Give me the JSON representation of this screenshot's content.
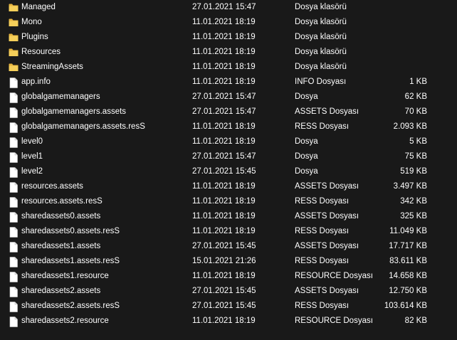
{
  "files": [
    {
      "name": "Managed",
      "date": "27.01.2021 15:47",
      "type": "Dosya klasörü",
      "size": "",
      "icon": "folder-icon"
    },
    {
      "name": "Mono",
      "date": "11.01.2021 18:19",
      "type": "Dosya klasörü",
      "size": "",
      "icon": "folder-icon"
    },
    {
      "name": "Plugins",
      "date": "11.01.2021 18:19",
      "type": "Dosya klasörü",
      "size": "",
      "icon": "folder-icon"
    },
    {
      "name": "Resources",
      "date": "11.01.2021 18:19",
      "type": "Dosya klasörü",
      "size": "",
      "icon": "folder-icon"
    },
    {
      "name": "StreamingAssets",
      "date": "11.01.2021 18:19",
      "type": "Dosya klasörü",
      "size": "",
      "icon": "folder-icon"
    },
    {
      "name": "app.info",
      "date": "11.01.2021 18:19",
      "type": "INFO Dosyası",
      "size": "1 KB",
      "icon": "file-icon"
    },
    {
      "name": "globalgamemanagers",
      "date": "27.01.2021 15:47",
      "type": "Dosya",
      "size": "62 KB",
      "icon": "file-icon"
    },
    {
      "name": "globalgamemanagers.assets",
      "date": "27.01.2021 15:47",
      "type": "ASSETS Dosyası",
      "size": "70 KB",
      "icon": "file-icon"
    },
    {
      "name": "globalgamemanagers.assets.resS",
      "date": "11.01.2021 18:19",
      "type": "RESS Dosyası",
      "size": "2.093 KB",
      "icon": "file-icon"
    },
    {
      "name": "level0",
      "date": "11.01.2021 18:19",
      "type": "Dosya",
      "size": "5 KB",
      "icon": "file-icon"
    },
    {
      "name": "level1",
      "date": "27.01.2021 15:47",
      "type": "Dosya",
      "size": "75 KB",
      "icon": "file-icon"
    },
    {
      "name": "level2",
      "date": "27.01.2021 15:45",
      "type": "Dosya",
      "size": "519 KB",
      "icon": "file-icon"
    },
    {
      "name": "resources.assets",
      "date": "11.01.2021 18:19",
      "type": "ASSETS Dosyası",
      "size": "3.497 KB",
      "icon": "file-icon"
    },
    {
      "name": "resources.assets.resS",
      "date": "11.01.2021 18:19",
      "type": "RESS Dosyası",
      "size": "342 KB",
      "icon": "file-icon"
    },
    {
      "name": "sharedassets0.assets",
      "date": "11.01.2021 18:19",
      "type": "ASSETS Dosyası",
      "size": "325 KB",
      "icon": "file-icon"
    },
    {
      "name": "sharedassets0.assets.resS",
      "date": "11.01.2021 18:19",
      "type": "RESS Dosyası",
      "size": "11.049 KB",
      "icon": "file-icon"
    },
    {
      "name": "sharedassets1.assets",
      "date": "27.01.2021 15:45",
      "type": "ASSETS Dosyası",
      "size": "17.717 KB",
      "icon": "file-icon"
    },
    {
      "name": "sharedassets1.assets.resS",
      "date": "15.01.2021 21:26",
      "type": "RESS Dosyası",
      "size": "83.611 KB",
      "icon": "file-icon"
    },
    {
      "name": "sharedassets1.resource",
      "date": "11.01.2021 18:19",
      "type": "RESOURCE Dosyası",
      "size": "14.658 KB",
      "icon": "file-icon"
    },
    {
      "name": "sharedassets2.assets",
      "date": "27.01.2021 15:45",
      "type": "ASSETS Dosyası",
      "size": "12.750 KB",
      "icon": "file-icon"
    },
    {
      "name": "sharedassets2.assets.resS",
      "date": "27.01.2021 15:45",
      "type": "RESS Dosyası",
      "size": "103.614 KB",
      "icon": "file-icon"
    },
    {
      "name": "sharedassets2.resource",
      "date": "11.01.2021 18:19",
      "type": "RESOURCE Dosyası",
      "size": "82 KB",
      "icon": "file-icon"
    }
  ],
  "colors": {
    "background": "#191919",
    "text": "#ffffff",
    "folder": "#f0c64a"
  }
}
